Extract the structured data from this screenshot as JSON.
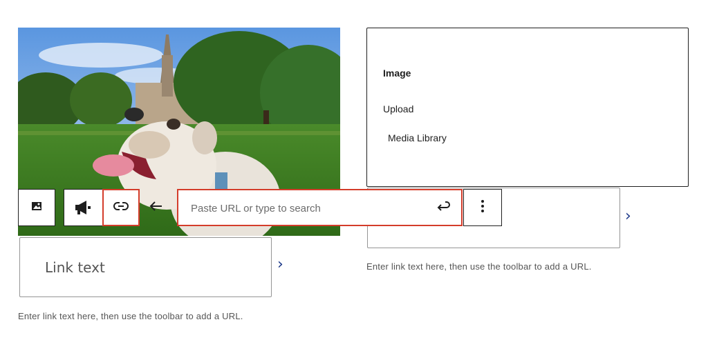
{
  "upload_panel": {
    "title": "Image",
    "upload_label": "Upload",
    "media_library_label": "Media Library"
  },
  "link_block_left": {
    "placeholder": "Link text",
    "help": "Enter link text here, then use the toolbar to add a URL."
  },
  "link_block_right": {
    "help": "Enter link text here, then use the toolbar to add a URL."
  },
  "toolbar": {
    "url_placeholder": "Paste URL or type to search",
    "icons": {
      "image": "image-icon",
      "megaphone": "megaphone-icon",
      "link": "link-icon",
      "back": "arrow-left-icon",
      "submit": "enter-return-icon",
      "more": "more-vertical-icon"
    }
  },
  "colors": {
    "highlight": "#d43c2a",
    "chevron": "#1e3a8a",
    "help_text": "#555555"
  }
}
